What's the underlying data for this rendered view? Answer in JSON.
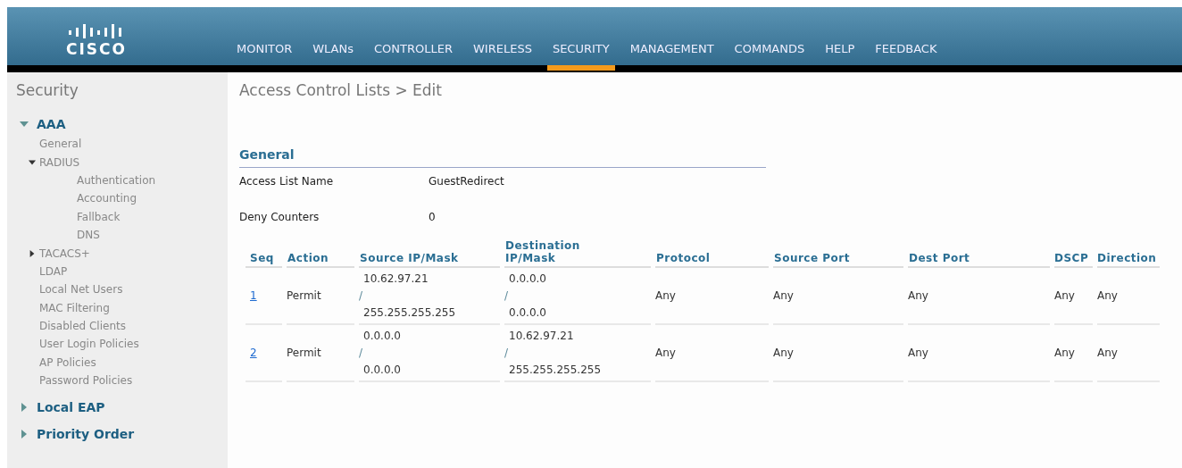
{
  "logo": {
    "text": "CISCO"
  },
  "nav": [
    {
      "label": "MONITOR",
      "selected": false
    },
    {
      "label": "WLANs",
      "selected": false
    },
    {
      "label": "CONTROLLER",
      "selected": false
    },
    {
      "label": "WIRELESS",
      "selected": false
    },
    {
      "label": "SECURITY",
      "selected": true
    },
    {
      "label": "MANAGEMENT",
      "selected": false
    },
    {
      "label": "COMMANDS",
      "selected": false
    },
    {
      "label": "HELP",
      "selected": false
    },
    {
      "label": "FEEDBACK",
      "selected": false
    }
  ],
  "sidebar": {
    "title": "Security",
    "items": [
      {
        "label": "AAA",
        "expanded": true,
        "children": [
          {
            "label": "General"
          },
          {
            "label": "RADIUS",
            "expanded": true,
            "children": [
              {
                "label": "Authentication"
              },
              {
                "label": "Accounting"
              },
              {
                "label": "Fallback"
              },
              {
                "label": "DNS"
              }
            ]
          },
          {
            "label": "TACACS+",
            "expanded": false
          },
          {
            "label": "LDAP"
          },
          {
            "label": "Local Net Users"
          },
          {
            "label": "MAC Filtering"
          },
          {
            "label": "Disabled Clients"
          },
          {
            "label": "User Login Policies"
          },
          {
            "label": "AP Policies"
          },
          {
            "label": "Password Policies"
          }
        ]
      },
      {
        "label": "Local EAP",
        "expanded": false
      },
      {
        "label": "Priority Order",
        "expanded": false
      }
    ]
  },
  "page": {
    "title": "Access Control Lists > Edit",
    "section": "General",
    "fields": [
      {
        "label": "Access List Name",
        "value": "GuestRedirect"
      },
      {
        "label": "Deny Counters",
        "value": "0"
      }
    ]
  },
  "table": {
    "columns": [
      "Seq",
      "Action",
      "Source IP/Mask",
      "Destination IP/Mask",
      "Protocol",
      "Source Port",
      "Dest Port",
      "DSCP",
      "Direction"
    ],
    "rows": [
      {
        "seq": "1",
        "action": "Permit",
        "source": {
          "address": "10.62.97.21",
          "separator": "/",
          "mask": "255.255.255.255"
        },
        "destination": {
          "address": "0.0.0.0",
          "separator": "/",
          "mask": "0.0.0.0"
        },
        "protocol": "Any",
        "source_port": "Any",
        "dest_port": "Any",
        "dscp": "Any",
        "direction": "Any"
      },
      {
        "seq": "2",
        "action": "Permit",
        "source": {
          "address": "0.0.0.0",
          "separator": "/",
          "mask": "0.0.0.0"
        },
        "destination": {
          "address": "10.62.97.21",
          "separator": "/",
          "mask": "255.255.255.255"
        },
        "protocol": "Any",
        "source_port": "Any",
        "dest_port": "Any",
        "dscp": "Any",
        "direction": "Any"
      }
    ]
  }
}
